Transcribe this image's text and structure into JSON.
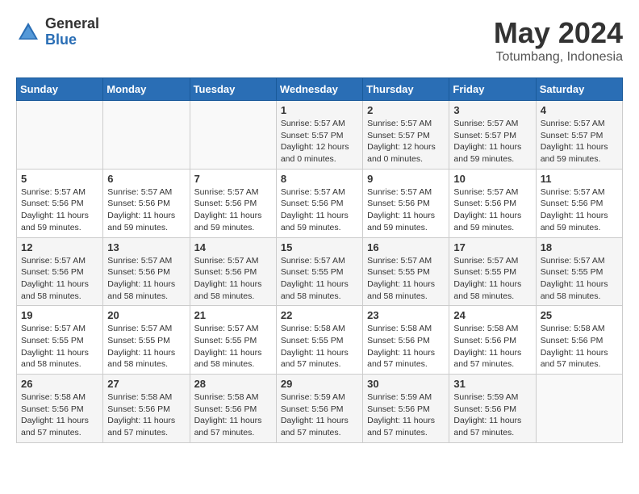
{
  "header": {
    "logo_general": "General",
    "logo_blue": "Blue",
    "month_title": "May 2024",
    "location": "Totumbang, Indonesia"
  },
  "days_of_week": [
    "Sunday",
    "Monday",
    "Tuesday",
    "Wednesday",
    "Thursday",
    "Friday",
    "Saturday"
  ],
  "weeks": [
    [
      {
        "day": "",
        "info": ""
      },
      {
        "day": "",
        "info": ""
      },
      {
        "day": "",
        "info": ""
      },
      {
        "day": "1",
        "info": "Sunrise: 5:57 AM\nSunset: 5:57 PM\nDaylight: 12 hours and 0 minutes."
      },
      {
        "day": "2",
        "info": "Sunrise: 5:57 AM\nSunset: 5:57 PM\nDaylight: 12 hours and 0 minutes."
      },
      {
        "day": "3",
        "info": "Sunrise: 5:57 AM\nSunset: 5:57 PM\nDaylight: 11 hours and 59 minutes."
      },
      {
        "day": "4",
        "info": "Sunrise: 5:57 AM\nSunset: 5:57 PM\nDaylight: 11 hours and 59 minutes."
      }
    ],
    [
      {
        "day": "5",
        "info": "Sunrise: 5:57 AM\nSunset: 5:56 PM\nDaylight: 11 hours and 59 minutes."
      },
      {
        "day": "6",
        "info": "Sunrise: 5:57 AM\nSunset: 5:56 PM\nDaylight: 11 hours and 59 minutes."
      },
      {
        "day": "7",
        "info": "Sunrise: 5:57 AM\nSunset: 5:56 PM\nDaylight: 11 hours and 59 minutes."
      },
      {
        "day": "8",
        "info": "Sunrise: 5:57 AM\nSunset: 5:56 PM\nDaylight: 11 hours and 59 minutes."
      },
      {
        "day": "9",
        "info": "Sunrise: 5:57 AM\nSunset: 5:56 PM\nDaylight: 11 hours and 59 minutes."
      },
      {
        "day": "10",
        "info": "Sunrise: 5:57 AM\nSunset: 5:56 PM\nDaylight: 11 hours and 59 minutes."
      },
      {
        "day": "11",
        "info": "Sunrise: 5:57 AM\nSunset: 5:56 PM\nDaylight: 11 hours and 59 minutes."
      }
    ],
    [
      {
        "day": "12",
        "info": "Sunrise: 5:57 AM\nSunset: 5:56 PM\nDaylight: 11 hours and 58 minutes."
      },
      {
        "day": "13",
        "info": "Sunrise: 5:57 AM\nSunset: 5:56 PM\nDaylight: 11 hours and 58 minutes."
      },
      {
        "day": "14",
        "info": "Sunrise: 5:57 AM\nSunset: 5:56 PM\nDaylight: 11 hours and 58 minutes."
      },
      {
        "day": "15",
        "info": "Sunrise: 5:57 AM\nSunset: 5:55 PM\nDaylight: 11 hours and 58 minutes."
      },
      {
        "day": "16",
        "info": "Sunrise: 5:57 AM\nSunset: 5:55 PM\nDaylight: 11 hours and 58 minutes."
      },
      {
        "day": "17",
        "info": "Sunrise: 5:57 AM\nSunset: 5:55 PM\nDaylight: 11 hours and 58 minutes."
      },
      {
        "day": "18",
        "info": "Sunrise: 5:57 AM\nSunset: 5:55 PM\nDaylight: 11 hours and 58 minutes."
      }
    ],
    [
      {
        "day": "19",
        "info": "Sunrise: 5:57 AM\nSunset: 5:55 PM\nDaylight: 11 hours and 58 minutes."
      },
      {
        "day": "20",
        "info": "Sunrise: 5:57 AM\nSunset: 5:55 PM\nDaylight: 11 hours and 58 minutes."
      },
      {
        "day": "21",
        "info": "Sunrise: 5:57 AM\nSunset: 5:55 PM\nDaylight: 11 hours and 58 minutes."
      },
      {
        "day": "22",
        "info": "Sunrise: 5:58 AM\nSunset: 5:55 PM\nDaylight: 11 hours and 57 minutes."
      },
      {
        "day": "23",
        "info": "Sunrise: 5:58 AM\nSunset: 5:56 PM\nDaylight: 11 hours and 57 minutes."
      },
      {
        "day": "24",
        "info": "Sunrise: 5:58 AM\nSunset: 5:56 PM\nDaylight: 11 hours and 57 minutes."
      },
      {
        "day": "25",
        "info": "Sunrise: 5:58 AM\nSunset: 5:56 PM\nDaylight: 11 hours and 57 minutes."
      }
    ],
    [
      {
        "day": "26",
        "info": "Sunrise: 5:58 AM\nSunset: 5:56 PM\nDaylight: 11 hours and 57 minutes."
      },
      {
        "day": "27",
        "info": "Sunrise: 5:58 AM\nSunset: 5:56 PM\nDaylight: 11 hours and 57 minutes."
      },
      {
        "day": "28",
        "info": "Sunrise: 5:58 AM\nSunset: 5:56 PM\nDaylight: 11 hours and 57 minutes."
      },
      {
        "day": "29",
        "info": "Sunrise: 5:59 AM\nSunset: 5:56 PM\nDaylight: 11 hours and 57 minutes."
      },
      {
        "day": "30",
        "info": "Sunrise: 5:59 AM\nSunset: 5:56 PM\nDaylight: 11 hours and 57 minutes."
      },
      {
        "day": "31",
        "info": "Sunrise: 5:59 AM\nSunset: 5:56 PM\nDaylight: 11 hours and 57 minutes."
      },
      {
        "day": "",
        "info": ""
      }
    ]
  ]
}
